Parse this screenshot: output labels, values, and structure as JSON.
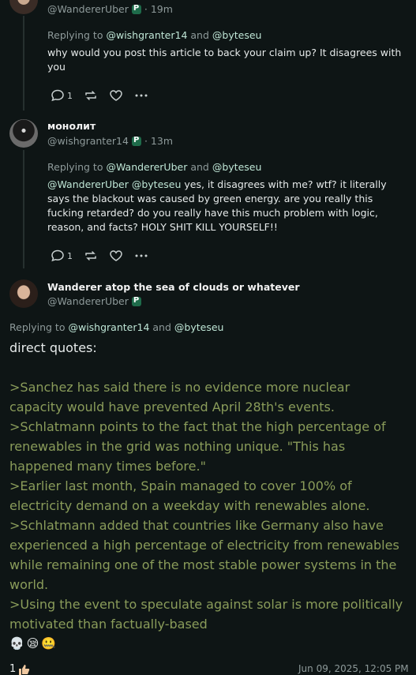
{
  "post1": {
    "handle": "@WandererUber",
    "time": "19m",
    "replying_prefix": "Replying to",
    "replying_to_1": "@wishgranter14",
    "replying_and": "and",
    "replying_to_2": "@byteseu",
    "body": "why would you post this article to back your claim up? It disagrees with you",
    "reply_count": "1"
  },
  "post2": {
    "display_name": "монолит",
    "handle": "@wishgranter14",
    "time": "13m",
    "replying_prefix": "Replying to",
    "replying_to_1": "@WandererUber",
    "replying_and": "and",
    "replying_to_2": "@byteseu",
    "body_mentions": "@WandererUber @byteseu",
    "body": " yes, it disagrees with me?  wtf?  it literally says the blackout was caused by green energy.  are you really this fucking retarded?  do you really have this much problem with logic, reason, and facts?  HOLY SHIT KILL YOURSELF!!",
    "reply_count": "1"
  },
  "post3": {
    "display_name": "Wanderer atop the sea of clouds or whatever",
    "handle": "@WandererUber",
    "replying_prefix": "Replying to",
    "replying_to_1": "@wishgranter14",
    "replying_and": "and",
    "replying_to_2": "@byteseu",
    "intro": "direct quotes:",
    "quotes": [
      ">Sanchez has said there is no evidence more nuclear capacity would have prevented April 28th's events.",
      ">Schlatmann points to the fact that the high percentage of renewables in the grid was nothing unique. \"This has happened many times before.\"",
      ">Earlier last month, Spain managed to cover 100% of electricity demand on a weekday with renewables alone.",
      ">Schlatmann added that countries like Germany also have experienced a high percentage of electricity from renewables while remaining one of the most stable power systems in the world.",
      ">Using the event to speculate against solar is more politically motivated than factually-based"
    ],
    "emojis": [
      "💀",
      "😪",
      "🤐"
    ],
    "like_count": "1",
    "timestamp": "Jun 09, 2025, 12:05 PM"
  }
}
